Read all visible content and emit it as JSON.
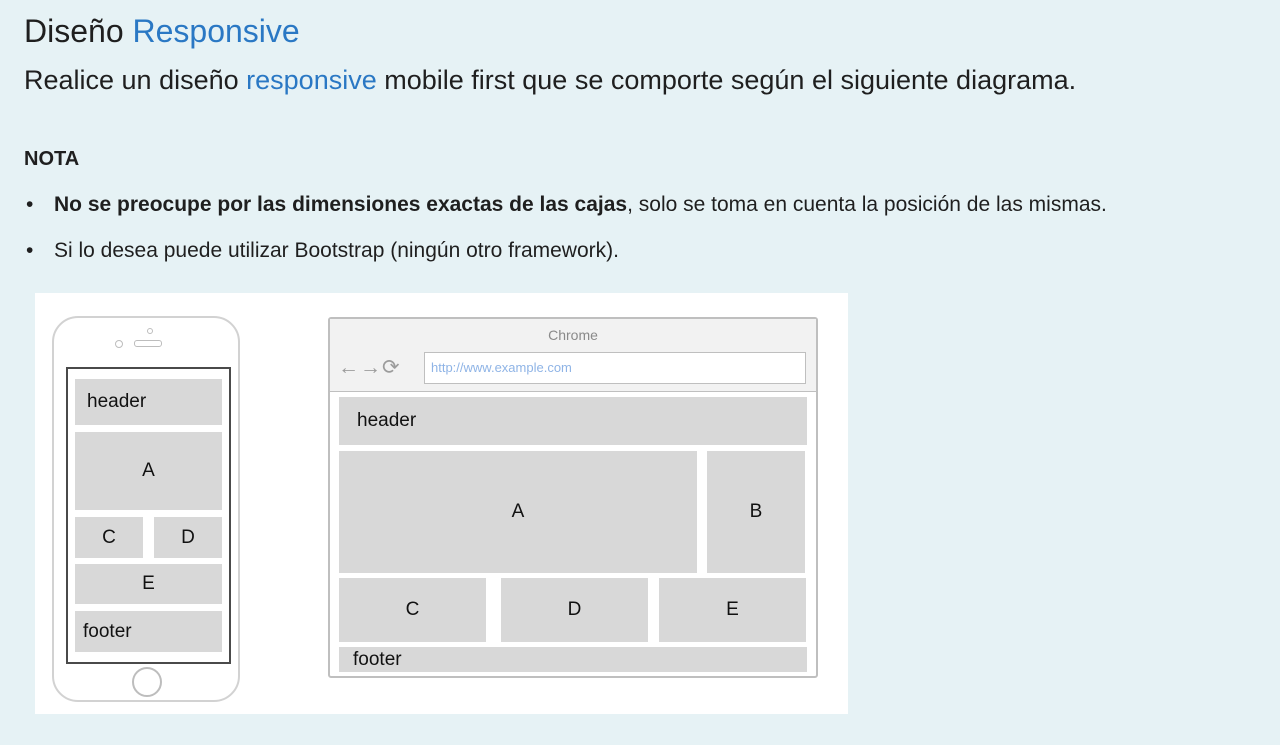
{
  "heading": {
    "prefix": "Diseño",
    "accent": "Responsive"
  },
  "intro": {
    "before": "Realice un diseño ",
    "link": "responsive",
    "after": " mobile first que se comporte según el siguiente diagrama."
  },
  "nota": {
    "label": "NOTA",
    "items": [
      {
        "bold": "No se preocupe por las dimensiones exactas de las cajas",
        "text": ", solo se toma en cuenta la posición de las mismas."
      },
      {
        "bold": "",
        "text": "Si lo desea puede utilizar Bootstrap (ningún otro framework)."
      }
    ]
  },
  "diagram": {
    "mobile": {
      "header": "header",
      "a": "A",
      "c": "C",
      "d": "D",
      "e": "E",
      "footer": "footer"
    },
    "desktop": {
      "browser_title": "Chrome",
      "url": "http://www.example.com",
      "header": "header",
      "a": "A",
      "b": "B",
      "c": "C",
      "d": "D",
      "e": "E",
      "footer": "footer"
    }
  },
  "colors": {
    "background": "#e6f2f5",
    "accent": "#2a78c4",
    "box": "#d8d8d8"
  }
}
